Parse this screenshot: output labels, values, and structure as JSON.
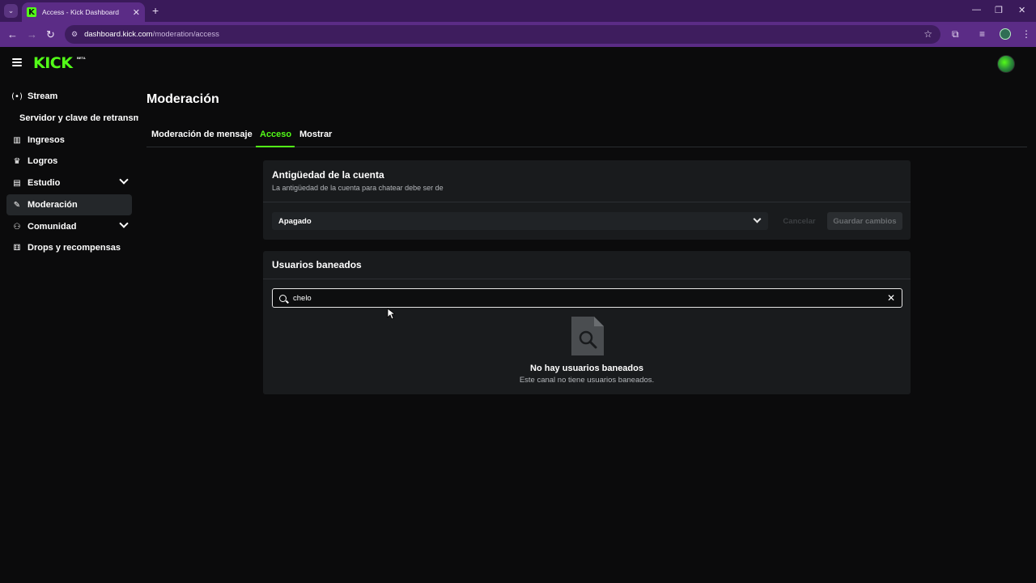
{
  "browser": {
    "tab_title": "Access - Kick Dashboard",
    "url_host": "dashboard.kick.com",
    "url_path": "/moderation/access"
  },
  "app": {
    "logo_text": "KICK",
    "logo_badge": "BETA"
  },
  "sidebar": {
    "items": [
      {
        "label": "Stream",
        "icon": "broadcast-icon"
      },
      {
        "label": "Servidor y clave de retransmisión",
        "icon": ""
      },
      {
        "label": "Ingresos",
        "icon": "chart-icon"
      },
      {
        "label": "Logros",
        "icon": "trophy-icon"
      },
      {
        "label": "Estudio",
        "icon": "studio-icon"
      },
      {
        "label": "Moderación",
        "icon": "wrench-icon"
      },
      {
        "label": "Comunidad",
        "icon": "users-icon"
      },
      {
        "label": "Drops y recompensas",
        "icon": "gift-icon"
      }
    ]
  },
  "page": {
    "title": "Moderación",
    "tabs": [
      "Moderación de mensaje",
      "Acceso",
      "Mostrar"
    ],
    "active_tab": "Acceso"
  },
  "account_age": {
    "title": "Antigüedad de la cuenta",
    "subtitle": "La antigüedad de la cuenta para chatear debe ser de",
    "select_value": "Apagado",
    "cancel_label": "Cancelar",
    "save_label": "Guardar cambios"
  },
  "banned": {
    "title": "Usuarios baneados",
    "search_value": "chelo",
    "empty_title": "No hay usuarios baneados",
    "empty_subtitle": "Este canal no tiene usuarios baneados."
  },
  "colors": {
    "accent": "#53fc18",
    "browser_frame": "#5b2c86",
    "background": "#0b0b0c",
    "card": "#191b1d"
  }
}
